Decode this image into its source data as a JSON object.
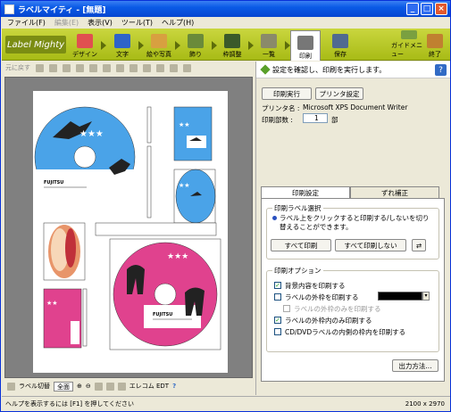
{
  "window": {
    "title": "ラベルマイティ - [無題]",
    "min": "_",
    "max": "□",
    "close": "×"
  },
  "menu": [
    "ファイル(F)",
    "編集(E)",
    "表示(V)",
    "ツール(T)",
    "ヘルプ(H)"
  ],
  "ribbon": {
    "logo": "Label Mighty",
    "buttons": [
      "デザイン",
      "文字",
      "絵や写真",
      "飾り",
      "枠調整",
      "一覧",
      "印刷",
      "保存"
    ],
    "right_buttons": [
      "ガイドメニュー",
      "終了"
    ]
  },
  "toolbar": {
    "undo_label": "元に戻す"
  },
  "bottom": {
    "label_switch": "ラベル切替",
    "zoom_all": "全面",
    "printer": "エレコム EDT"
  },
  "status": {
    "left": "ヘルプを表示するには [F1] を押してください",
    "right": "2100 x 2970"
  },
  "panel": {
    "header": "設定を確認し、印刷を実行します。",
    "help": "?",
    "print_button": "印刷実行",
    "printer_settings_button": "プリンタ設定",
    "printer_name_label": "プリンタ名 :",
    "printer_name": "Microsoft XPS Document Writer",
    "copies_label": "印刷部数 :",
    "copies": "1",
    "copies_unit": "部",
    "tabs": [
      "印刷設定",
      "ずれ補正"
    ],
    "label_select_title": "印刷ラベル選択",
    "label_select_desc": "ラベル上をクリックすると印刷する/しないを切り替えることができます。",
    "print_all": "すべて印刷",
    "print_none": "すべて印刷しない",
    "options_title": "印刷オプション",
    "options": [
      {
        "label": "背景内容を印刷する",
        "checked": true,
        "disabled": false
      },
      {
        "label": "ラベルの外枠を印刷する",
        "checked": false,
        "disabled": false
      },
      {
        "label": "ラベルの外枠のみを印刷する",
        "checked": false,
        "disabled": true
      },
      {
        "label": "ラベルの外枠内のみ印刷する",
        "checked": true,
        "disabled": false
      },
      {
        "label": "CD/DVDラベルの内側の枠内を印刷する",
        "checked": false,
        "disabled": false
      }
    ],
    "output_method": "出力方法..."
  },
  "labels": {
    "brand": "FUJITSU"
  }
}
